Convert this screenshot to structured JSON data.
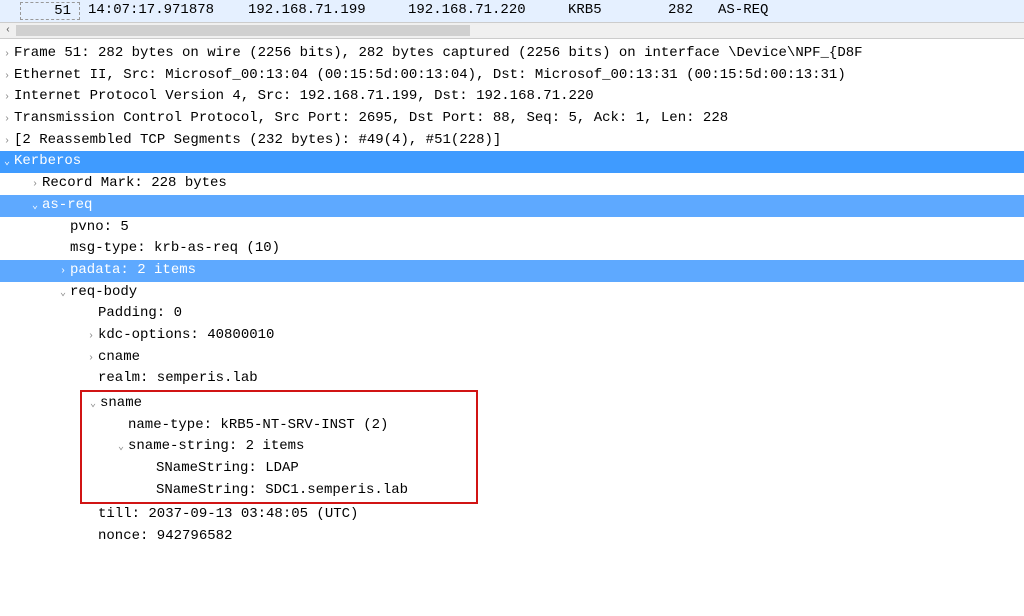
{
  "packet": {
    "no": "51",
    "time": "14:07:17.971878",
    "src": "192.168.71.199",
    "dst": "192.168.71.220",
    "proto": "KRB5",
    "len": "282",
    "info": "AS-REQ"
  },
  "details": {
    "frame": "Frame 51: 282 bytes on wire (2256 bits), 282 bytes captured (2256 bits) on interface \\Device\\NPF_{D8F",
    "eth": "Ethernet II, Src: Microsof_00:13:04 (00:15:5d:00:13:04), Dst: Microsof_00:13:31 (00:15:5d:00:13:31)",
    "ip": "Internet Protocol Version 4, Src: 192.168.71.199, Dst: 192.168.71.220",
    "tcp": "Transmission Control Protocol, Src Port: 2695, Dst Port: 88, Seq: 5, Ack: 1, Len: 228",
    "reasm": "[2 Reassembled TCP Segments (232 bytes): #49(4), #51(228)]",
    "krb": "Kerberos",
    "recmark": "Record Mark: 228 bytes",
    "asreq": "as-req",
    "pvno": "pvno: 5",
    "msgtype": "msg-type: krb-as-req (10)",
    "padata": "padata: 2 items",
    "reqbody": "req-body",
    "padding": "Padding: 0",
    "kdcoptions": "kdc-options: 40800010",
    "cname": "cname",
    "realm": "realm: semperis.lab",
    "sname": "sname",
    "nametype": "name-type: kRB5-NT-SRV-INST (2)",
    "snamestring": "sname-string: 2 items",
    "sns1": "SNameString: LDAP",
    "sns2": "SNameString: SDC1.semperis.lab",
    "till": "till: 2037-09-13 03:48:05 (UTC)",
    "nonce": "nonce: 942796582"
  },
  "glyph": {
    "right": "›",
    "down": "⌄",
    "left_scroll": "‹"
  }
}
